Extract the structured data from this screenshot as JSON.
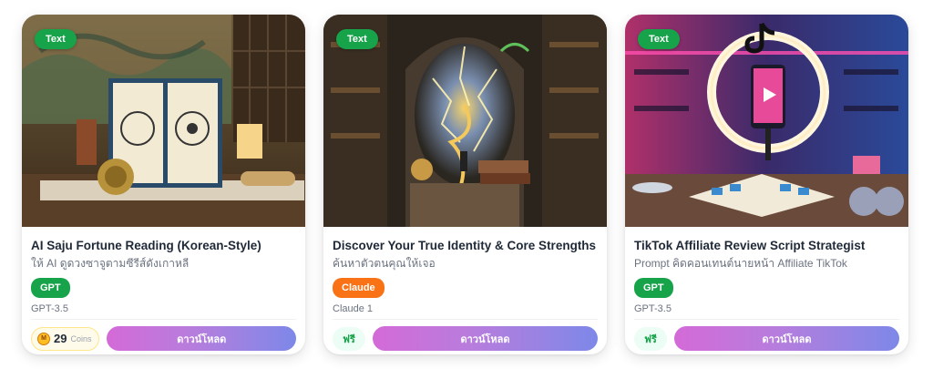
{
  "cards": [
    {
      "type_label": "Text",
      "title": "AI Saju Fortune Reading (Korean-Style)",
      "subtitle": "ให้ AI ดูดวงซาจูตามซีรีส์ดังเกาหลี",
      "model_badge": "GPT",
      "model_name": "GPT-3.5",
      "price": {
        "amount": "29",
        "label": "Coins",
        "coin_symbol": "M"
      },
      "download_label": "ดาวน์โหลด",
      "image_icon": "fortune-book-image"
    },
    {
      "type_label": "Text",
      "title": "Discover Your True Identity & Core Strengths",
      "subtitle": "ค้นหาตัวตนคุณให้เจอ",
      "model_badge": "Claude",
      "model_name": "Claude 1",
      "price": {
        "label": "ฟรี"
      },
      "download_label": "ดาวน์โหลด",
      "image_icon": "cracked-head-image"
    },
    {
      "type_label": "Text",
      "title": "TikTok Affiliate Review Script Strategist",
      "subtitle": "Prompt คิดคอนเทนต์นายหน้า Affiliate TikTok",
      "model_badge": "GPT",
      "model_name": "GPT-3.5",
      "price": {
        "label": "ฟรี"
      },
      "download_label": "ดาวน์โหลด",
      "image_icon": "tiktok-studio-image"
    }
  ],
  "colors": {
    "text_badge": "#16a34a",
    "gpt_badge": "#16a34a",
    "claude_badge": "#f97316",
    "download_gradient_start": "#d46ad7",
    "download_gradient_end": "#7d88e8"
  }
}
